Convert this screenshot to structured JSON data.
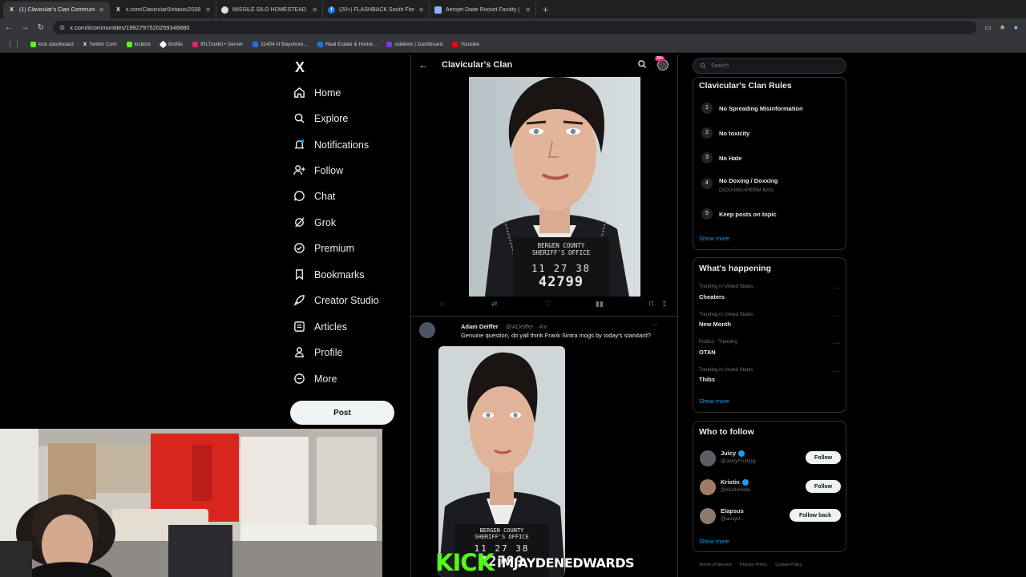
{
  "browser": {
    "tabs": [
      {
        "label": "(1) Clavicular's Clan Communit",
        "icon": "x-logo-icon",
        "active": true
      },
      {
        "label": "x.com/Clavicular0/status/2039",
        "icon": "x-logo-icon",
        "active": false
      },
      {
        "label": "MISSILE SILO HOMESTEAD - G",
        "icon": "globe-icon",
        "active": false
      },
      {
        "label": "(20+) FLASHBACK South Florid",
        "icon": "facebook-icon",
        "active": false
      },
      {
        "label": "Aerojet Dade Rocket Facility | ",
        "icon": "doc-icon",
        "active": false
      }
    ],
    "url": "x.com/i/communities/1992797520259346880",
    "bookmarks": [
      {
        "label": "kick dashboard",
        "color": "#53fc18"
      },
      {
        "label": "Twitter Com",
        "color": "#e7e9ea"
      },
      {
        "label": "kickbot",
        "color": "#53fc18"
      },
      {
        "label": "Botfile",
        "color": "#ffffff"
      },
      {
        "label": "IRLToolkit • Server",
        "color": "#e0245e"
      },
      {
        "label": "11404 N Bayshore...",
        "color": "#1a73e8"
      },
      {
        "label": "Real Estate & Home...",
        "color": "#1a73e8"
      },
      {
        "label": "sidekick | Dashboard",
        "color": "#7c3aed"
      },
      {
        "label": "Youtube",
        "color": "#ff0000"
      }
    ]
  },
  "nav": {
    "logo": "X",
    "items": [
      {
        "label": "Home",
        "icon": "home-icon"
      },
      {
        "label": "Explore",
        "icon": "search-icon"
      },
      {
        "label": "Notifications",
        "icon": "bell-icon"
      },
      {
        "label": "Follow",
        "icon": "person-add-icon"
      },
      {
        "label": "Chat",
        "icon": "chat-icon"
      },
      {
        "label": "Grok",
        "icon": "grok-icon"
      },
      {
        "label": "Premium",
        "icon": "premium-icon"
      },
      {
        "label": "Bookmarks",
        "icon": "bookmark-icon"
      },
      {
        "label": "Creator Studio",
        "icon": "rocket-icon"
      },
      {
        "label": "Articles",
        "icon": "article-icon"
      },
      {
        "label": "Profile",
        "icon": "person-icon"
      },
      {
        "label": "More",
        "icon": "more-icon"
      }
    ],
    "post_label": "Post"
  },
  "community": {
    "title": "Clavicular's Clan",
    "notif_badge": "20+"
  },
  "photo": {
    "placard_line1": "BERGEN COUNTY",
    "placard_line2": "SHERIFF'S OFFICE",
    "placard_date": "11 27 38",
    "placard_number": "42799"
  },
  "tweet": {
    "author": "Adam Deiffer",
    "handle": "@ADeiffer · 4m",
    "text": "Genuine question, do yall think Frank Sintra mogs by today's standard?"
  },
  "right": {
    "search_placeholder": "Search",
    "rules_title": "Clavicular's Clan Rules",
    "rules": [
      {
        "num": "1",
        "text": "No Spreading Misinformation",
        "sub": ""
      },
      {
        "num": "2",
        "text": "No toxicity",
        "sub": ""
      },
      {
        "num": "3",
        "text": "No Hate",
        "sub": ""
      },
      {
        "num": "4",
        "text": "No Doxing / Doxxing",
        "sub": "DOXXING=PERM BAN"
      },
      {
        "num": "5",
        "text": "Keep posts on topic",
        "sub": ""
      }
    ],
    "show_more": "Show more",
    "happening_title": "What's happening",
    "trends": [
      {
        "meta": "Trending in United States",
        "name": "Cheaters"
      },
      {
        "meta": "Trending in United States",
        "name": "New Month"
      },
      {
        "meta": "Politics · Trending",
        "name": "OTAN"
      },
      {
        "meta": "Trending in United States",
        "name": "Thibs"
      }
    ],
    "wtf_title": "Who to follow",
    "wtf": [
      {
        "name": "Juicy",
        "handle": "@JuicyFruityyy",
        "button": "Follow",
        "verified": true
      },
      {
        "name": "Kristin",
        "handle": "@KristoHate",
        "button": "Follow",
        "verified": true
      },
      {
        "name": "Elapsus",
        "handle": "@ausyd...",
        "button": "Follow back",
        "verified": false
      }
    ],
    "footer": [
      "Terms of Service",
      "Privacy Policy",
      "Cookie Policy"
    ]
  },
  "overlay": {
    "kick_logo": "KICK",
    "kick_user": "IMJAYDENEDWARDS"
  }
}
